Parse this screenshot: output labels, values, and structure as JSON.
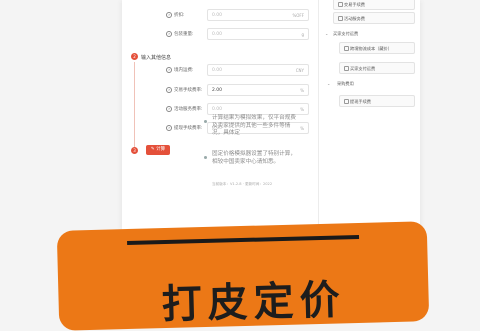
{
  "form": {
    "rows_top": [
      {
        "label": "折扣:",
        "value": "0.00",
        "unit": "%OFF",
        "dark": false
      },
      {
        "label": "包装重量:",
        "value": "0.00",
        "unit": "g",
        "dark": false
      }
    ],
    "section": {
      "step": "2",
      "title": "输入其他信息"
    },
    "rows_other": [
      {
        "label": "境内运费:",
        "value": "0.00",
        "unit": "CNY",
        "dark": false
      },
      {
        "label": "交易手续费率:",
        "value": "2.00",
        "unit": "%",
        "dark": true
      },
      {
        "label": "活动服务费率:",
        "value": "0.00",
        "unit": "%",
        "dark": false
      },
      {
        "label": "提现手续费率:",
        "value": "0.00",
        "unit": "%",
        "dark": false
      }
    ],
    "submit": {
      "step": "3",
      "label": "计算"
    }
  },
  "sidebar": {
    "tree": [
      {
        "text": "交易手续费",
        "type": "leaf"
      },
      {
        "text": "活动服务费",
        "type": "leaf"
      },
      {
        "text": "买家支付运费",
        "type": "group"
      },
      {
        "text": "跨境物流成本（藏价）",
        "type": "leaf"
      },
      {
        "text": "买家支付运费",
        "type": "leaf"
      },
      {
        "text": "采购费用",
        "type": "group"
      },
      {
        "text": "提现手续费",
        "type": "leaf"
      }
    ],
    "notes": [
      "计算结果为模拟效果，仅平台规费及卖家提供的其他一些多件等情况，具体定",
      "固定价格模拟器设置了特别计算，相较中国卖家中心请知悉。"
    ],
    "version": "当前版本：V1.2.8 · 更新时间：2022"
  },
  "banner": {
    "headline": "打皮定价"
  },
  "colors": {
    "accent": "#e4503a",
    "banner": "#ec7816"
  }
}
